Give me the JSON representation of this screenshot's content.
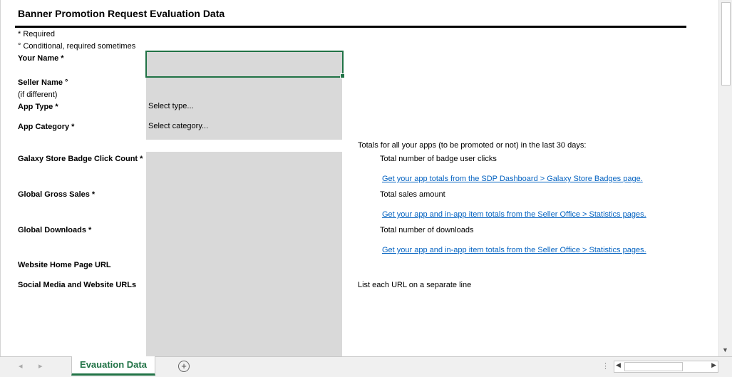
{
  "title": "Banner Promotion Request Evaluation Data",
  "legend": {
    "required": "* Required",
    "conditional": "° Conditional, required sometimes"
  },
  "fields": {
    "your_name": "Your Name *",
    "seller_name": "Seller Name °",
    "seller_name_sub": "(if different)",
    "app_type": "App Type *",
    "app_type_value": "Select type...",
    "app_category": "App Category *",
    "app_category_value": "Select category...",
    "badge_clicks": "Galaxy Store Badge Click Count *",
    "gross_sales": "Global Gross Sales *",
    "downloads": "Global Downloads *",
    "website_url": "Website Home Page URL",
    "social_urls": "Social Media and Website URLs"
  },
  "notes": {
    "totals_header": "Totals for all your apps (to be promoted or not) in the last 30 days:",
    "badge_clicks_desc": "Total number of badge user clicks",
    "badge_clicks_link": " Get your app totals from the SDP Dashboard > Galaxy Store Badges page.",
    "sales_desc": "Total sales amount",
    "sales_link": " Get your app and in-app item totals from the Seller Office > Statistics pages.",
    "downloads_desc": "Total number of downloads",
    "downloads_link": " Get your app and in-app item totals from the Seller Office > Statistics pages.",
    "social_desc": "List each URL on a separate line"
  },
  "tabs": {
    "active": "Evauation Data"
  },
  "colors": {
    "accent": "#217346",
    "link": "#0563c1",
    "input_fill": "#d9d9d9"
  }
}
